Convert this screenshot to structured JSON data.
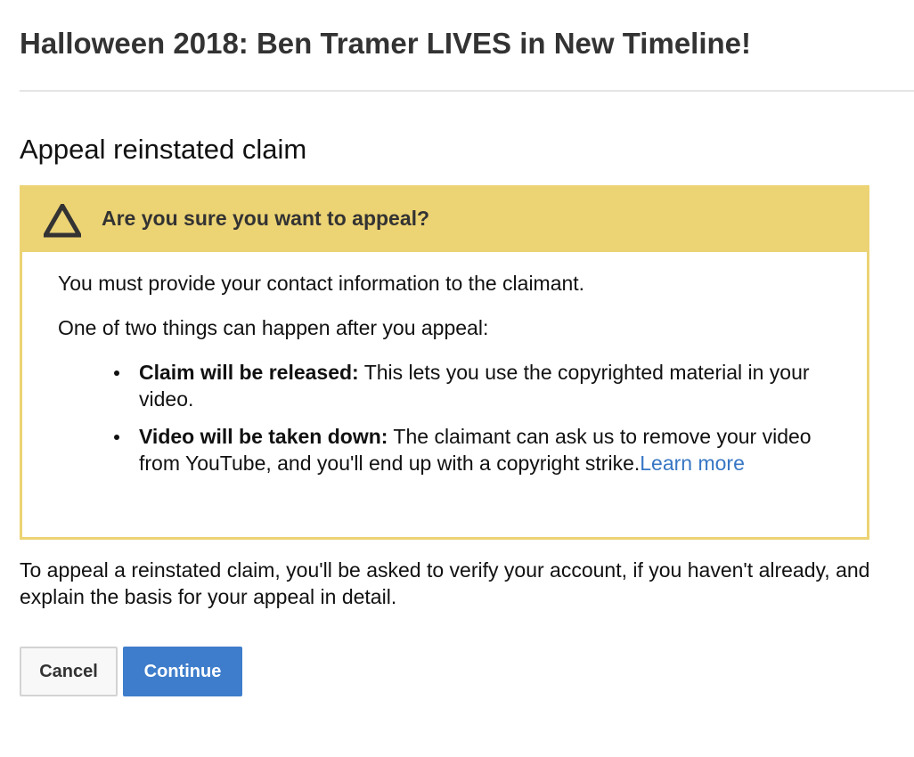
{
  "page": {
    "video_title": "Halloween 2018: Ben Tramer LIVES in New Timeline!",
    "heading": "Appeal reinstated claim"
  },
  "warning": {
    "icon": "warning-triangle-icon",
    "title": "Are you sure you want to appeal?",
    "intro": "You must provide your contact information to the claimant.",
    "lead": "One of two things can happen after you appeal:",
    "outcomes": [
      {
        "name": "Claim will be released:",
        "description": " This lets you use the copyrighted material in your video."
      },
      {
        "name": "Video will be taken down:",
        "description": " The claimant can ask us to remove your video from YouTube, and you'll end up with a copyright strike.",
        "link": "Learn more"
      }
    ]
  },
  "explanation": "To appeal a reinstated claim, you'll be asked to verify your account, if you haven't already, and explain the basis for your appeal in detail.",
  "buttons": {
    "cancel": "Cancel",
    "continue": "Continue"
  },
  "colors": {
    "warning_bg": "#ecd374",
    "link": "#3776c4",
    "primary_button": "#3e7dcb"
  }
}
